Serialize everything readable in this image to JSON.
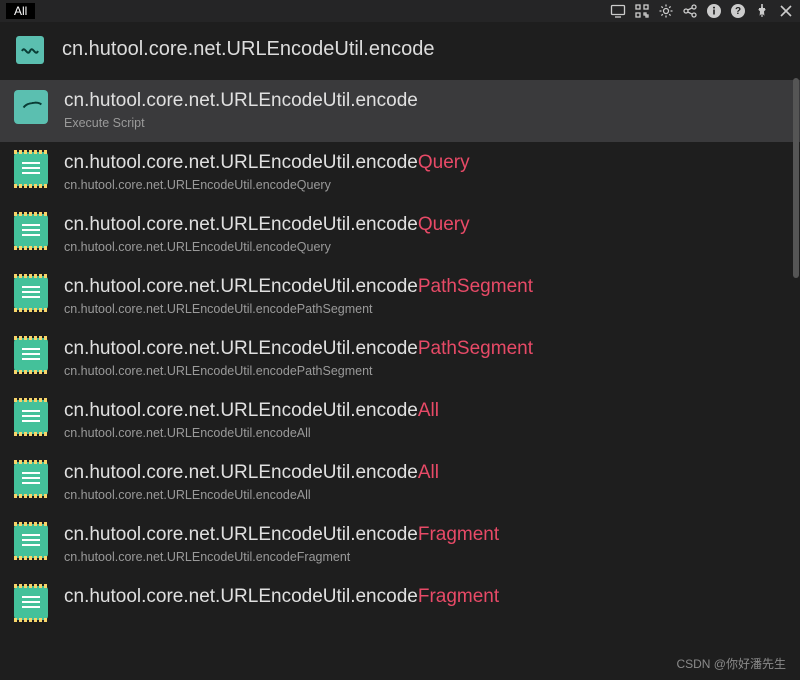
{
  "topbar": {
    "tab": "All"
  },
  "search": {
    "value": "cn.hutool.core.net.URLEncodeUtil.encode"
  },
  "results": [
    {
      "iconType": "teal-wave",
      "selected": true,
      "prefix": "cn.hutool.core.net.URLEncodeUtil.encode",
      "match": "",
      "subtitle": "Execute Script"
    },
    {
      "iconType": "green-doc",
      "selected": false,
      "prefix": "cn.hutool.core.net.URLEncodeUtil.encode",
      "match": "Query",
      "subtitle": "cn.hutool.core.net.URLEncodeUtil.encodeQuery"
    },
    {
      "iconType": "green-doc",
      "selected": false,
      "prefix": "cn.hutool.core.net.URLEncodeUtil.encode",
      "match": "Query",
      "subtitle": "cn.hutool.core.net.URLEncodeUtil.encodeQuery"
    },
    {
      "iconType": "green-doc",
      "selected": false,
      "prefix": "cn.hutool.core.net.URLEncodeUtil.encode",
      "match": "PathSegment",
      "subtitle": "cn.hutool.core.net.URLEncodeUtil.encodePathSegment"
    },
    {
      "iconType": "green-doc",
      "selected": false,
      "prefix": "cn.hutool.core.net.URLEncodeUtil.encode",
      "match": "PathSegment",
      "subtitle": "cn.hutool.core.net.URLEncodeUtil.encodePathSegment"
    },
    {
      "iconType": "green-doc",
      "selected": false,
      "prefix": "cn.hutool.core.net.URLEncodeUtil.encode",
      "match": "All",
      "subtitle": "cn.hutool.core.net.URLEncodeUtil.encodeAll"
    },
    {
      "iconType": "green-doc",
      "selected": false,
      "prefix": "cn.hutool.core.net.URLEncodeUtil.encode",
      "match": "All",
      "subtitle": "cn.hutool.core.net.URLEncodeUtil.encodeAll"
    },
    {
      "iconType": "green-doc",
      "selected": false,
      "prefix": "cn.hutool.core.net.URLEncodeUtil.encode",
      "match": "Fragment",
      "subtitle": "cn.hutool.core.net.URLEncodeUtil.encodeFragment"
    },
    {
      "iconType": "green-doc",
      "selected": false,
      "prefix": "cn.hutool.core.net.URLEncodeUtil.encode",
      "match": "Fragment",
      "subtitle": ""
    }
  ],
  "watermark": "CSDN @你好潘先生"
}
